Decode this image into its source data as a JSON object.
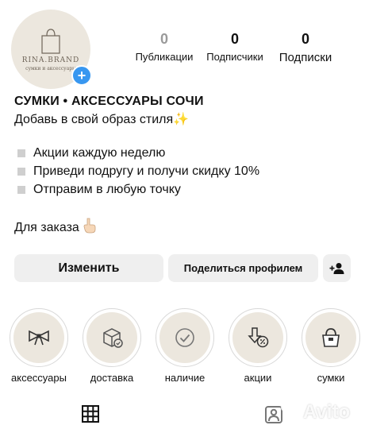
{
  "profile": {
    "avatar_brand": "RINA.BRAND",
    "avatar_sub": "сумки и аксессуары"
  },
  "stats": [
    {
      "value": "0",
      "label": "Публикации"
    },
    {
      "value": "0",
      "label": "Подписчики"
    },
    {
      "value": "0",
      "label": "Подписки"
    }
  ],
  "bio": {
    "title": "СУМКИ • АКСЕССУАРЫ СОЧИ",
    "tagline": "Добавь в свой образ стиля✨",
    "points": [
      "Акции каждую неделю",
      "Приведи подругу и получи скидку 10%",
      "Отправим в любую точку"
    ],
    "order": "Для заказа"
  },
  "actions": {
    "edit": "Изменить",
    "share": "Поделиться профилем"
  },
  "highlights": [
    {
      "label": "аксессуары",
      "icon": "bow-icon"
    },
    {
      "label": "доставка",
      "icon": "box-icon"
    },
    {
      "label": "наличие",
      "icon": "check-circle-icon"
    },
    {
      "label": "акции",
      "icon": "discount-icon"
    },
    {
      "label": "сумки",
      "icon": "handbag-icon"
    }
  ],
  "watermark": "Avito",
  "colors": {
    "accent_blue": "#3897f0",
    "button_bg": "#efefef",
    "highlight_bg": "#ece7de"
  }
}
